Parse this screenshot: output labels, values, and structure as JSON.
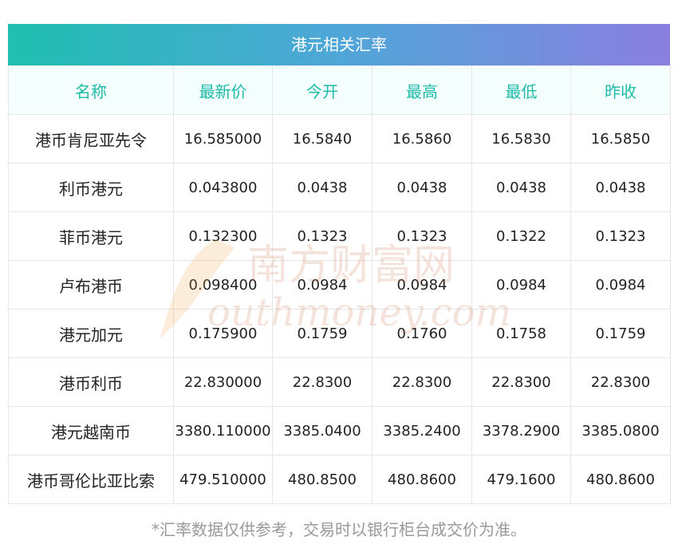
{
  "title": "港元相关汇率",
  "columns": [
    "名称",
    "最新价",
    "今开",
    "最高",
    "最低",
    "昨收"
  ],
  "rows": [
    [
      "港币肯尼亚先令",
      "16.585000",
      "16.5840",
      "16.5860",
      "16.5830",
      "16.5850"
    ],
    [
      "利币港元",
      "0.043800",
      "0.0438",
      "0.0438",
      "0.0438",
      "0.0438"
    ],
    [
      "菲币港元",
      "0.132300",
      "0.1323",
      "0.1323",
      "0.1322",
      "0.1323"
    ],
    [
      "卢布港币",
      "0.098400",
      "0.0984",
      "0.0984",
      "0.0984",
      "0.0984"
    ],
    [
      "港元加元",
      "0.175900",
      "0.1759",
      "0.1760",
      "0.1758",
      "0.1759"
    ],
    [
      "港币利币",
      "22.830000",
      "22.8300",
      "22.8300",
      "22.8300",
      "22.8300"
    ],
    [
      "港元越南币",
      "3380.110000",
      "3385.0400",
      "3385.2400",
      "3378.2900",
      "3385.0800"
    ],
    [
      "港币哥伦比亚比索",
      "479.510000",
      "480.8500",
      "480.8600",
      "479.1600",
      "480.8600"
    ]
  ],
  "footnote": "*汇率数据仅供参考，交易时以银行柜台成交价为准。",
  "watermark": {
    "cn": "南方财富网",
    "en": "outhmoney.com"
  },
  "colors": {
    "header_gradient_start": "#1fbfb0",
    "header_gradient_end": "#8b7fe0",
    "column_header_text": "#1dbaa9"
  }
}
